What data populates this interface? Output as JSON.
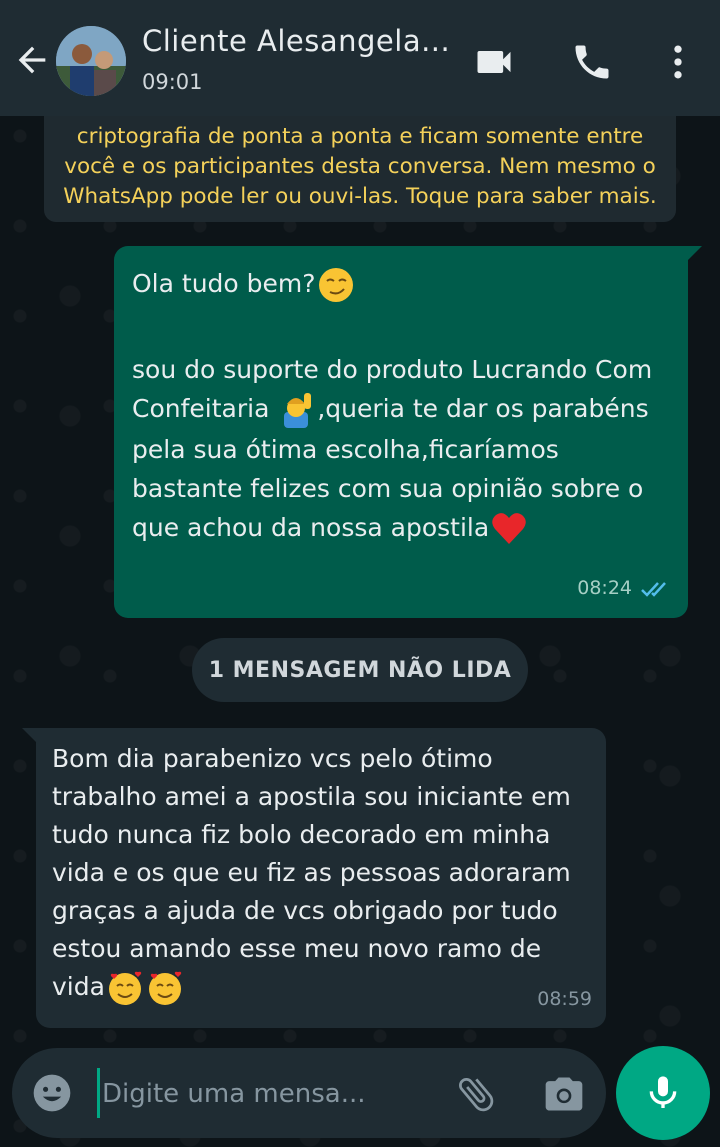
{
  "header": {
    "contact_name": "Cliente Alesangela...",
    "last_seen": "09:01"
  },
  "encryption_notice": "criptografia de ponta a ponta e ficam somente entre você e os participantes desta conversa. Nem mesmo o WhatsApp pode ler ou ouvi-las. Toque para saber mais.",
  "messages": {
    "outgoing": {
      "line1": "Ola tudo bem?",
      "line2_a": "sou do suporte do produto Lucrando Com Confeitaria ",
      "line2_b": ",queria te dar os parabéns pela sua ótima escolha,ficaríamos bastante felizes com sua opinião sobre o que achou da nossa apostila",
      "time": "08:24",
      "status_icon": "double-check-icon"
    },
    "unread_divider": "1 MENSAGEM NÃO LIDA",
    "incoming": {
      "text": "Bom dia  parabenizo vcs pelo ótimo trabalho amei a apostila sou iniciante em tudo nunca fiz bolo decorado em minha vida e os que eu fiz as pessoas adoraram graças a ajuda de vcs obrigado por tudo estou amando esse meu novo ramo de vida",
      "time": "08:59"
    }
  },
  "composer": {
    "placeholder": "Digite uma mensa..."
  },
  "colors": {
    "outgoing_bubble": "#005c4b",
    "incoming_bubble": "#1f2c33",
    "accent": "#00a884",
    "notice_text": "#f4d15a"
  }
}
